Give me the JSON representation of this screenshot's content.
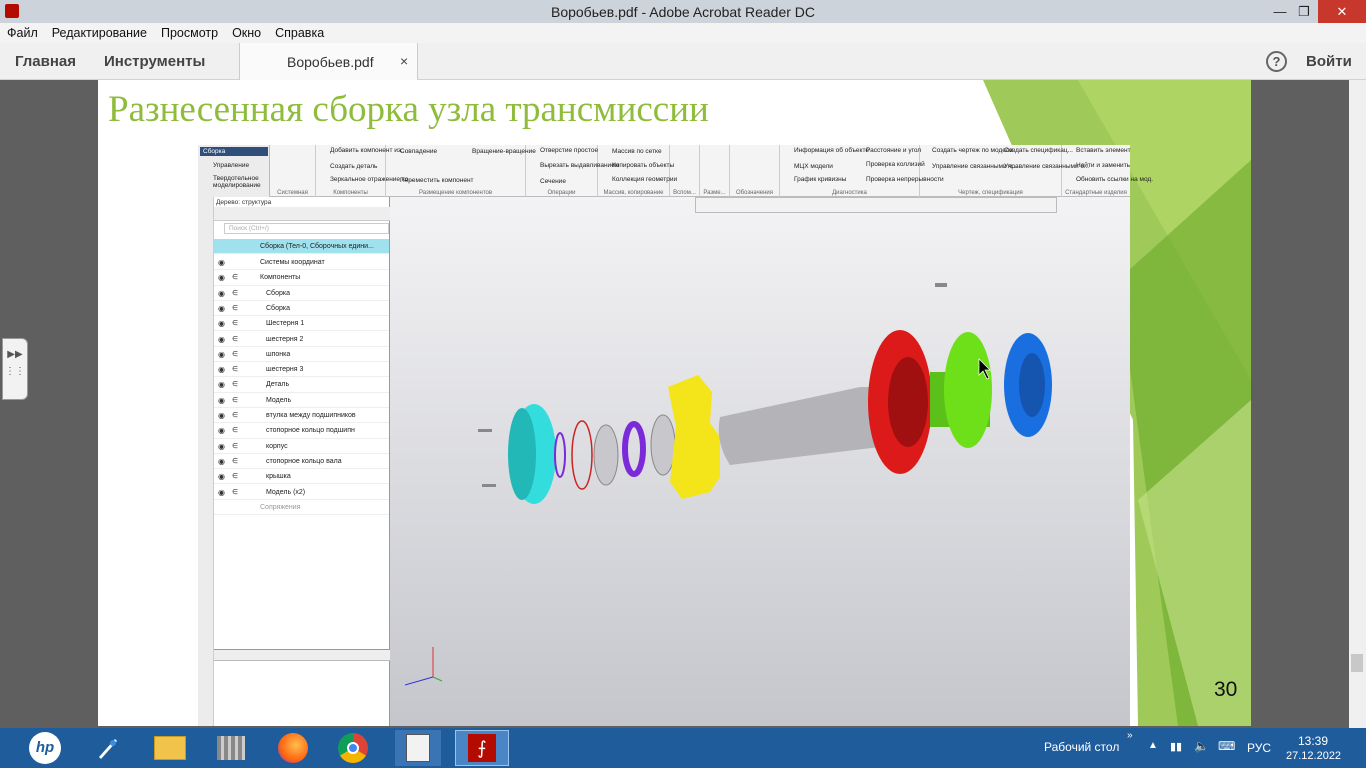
{
  "window": {
    "title": "Воробьев.pdf - Adobe Acrobat Reader DC",
    "minimize": "—",
    "restore": "❐",
    "close": "✕"
  },
  "menu": [
    "Файл",
    "Редактирование",
    "Просмотр",
    "Окно",
    "Справка"
  ],
  "tabs": {
    "home": "Главная",
    "tools": "Инструменты",
    "document": "Воробьев.pdf",
    "close_symbol": "×"
  },
  "header_right": {
    "help": "?",
    "login": "Войти"
  },
  "slide": {
    "title": "Разнесенная сборка узла трансмиссии",
    "page_number": "30"
  },
  "kompas": {
    "tree_tabs": [
      "Сборка",
      "Управление",
      "Твердотельное моделирование"
    ],
    "ribbon_groups": [
      {
        "label": "Системная",
        "items": []
      },
      {
        "label": "Компоненты",
        "items": [
          "Добавить компонент из...",
          "Создать деталь",
          "Зеркальное отражение ко..."
        ]
      },
      {
        "label": "Размещение компонентов",
        "items": [
          "Совпадение",
          "Вращение-вращение",
          "Переместить компонент"
        ]
      },
      {
        "label": "Операции",
        "items": [
          "Отверстие простое",
          "Вырезать выдавливанием",
          "Сечение"
        ]
      },
      {
        "label": "Массив, копирование",
        "items": [
          "Массив по сетке",
          "Копировать объекты",
          "Коллекция геометрии"
        ]
      },
      {
        "label": "Вспом...",
        "items": []
      },
      {
        "label": "Разме...",
        "items": []
      },
      {
        "label": "Обозначения",
        "items": []
      },
      {
        "label": "Диагностика",
        "items": [
          "Информация об объекте",
          "МЦХ модели",
          "График кривизны",
          "Расстояние и угол",
          "Проверка коллизий",
          "Проверка непрерывности"
        ]
      },
      {
        "label": "Чертеж, спецификация",
        "items": [
          "Создать чертеж по модели",
          "Управление связанными ч...",
          "Создать спецификац...",
          "Управление связанными с..."
        ]
      },
      {
        "label": "Стандартные изделия",
        "items": [
          "Вставить элемент",
          "Найти и заменить",
          "Обновить ссылки на мод."
        ]
      }
    ],
    "tree_header": "Дерево: структура",
    "search_placeholder": "Поиск (Ctrl+/)",
    "root_item": "Сборка (Тел-0, Сборочных едини...",
    "tree_items": [
      "Системы координат",
      "Компоненты",
      "Сборка",
      "Сборка",
      "Шестерня 1",
      "шестерня 2",
      "шпонка",
      "шестерня 3",
      "Деталь",
      "Модель",
      "втулка между подшипников",
      "стопорное кольцо подшипн",
      "корпус",
      "стопорное кольцо вала",
      "крышка",
      "Модель (x2)",
      "Сопряжения"
    ],
    "part_colors": {
      "flange": "#33dddd",
      "housing": "#f4e41a",
      "gear_red": "#dd1a1a",
      "gear_green": "#6ee01a",
      "gear_blue": "#1a6fe0",
      "ring": "#7a2ad8",
      "shaft": "#b4b4b8"
    }
  },
  "taskbar": {
    "desktop_label": "Рабочий стол",
    "language": "РУС",
    "time": "13:39",
    "date": "27.12.2022"
  },
  "colors": {
    "title_green": "#8fbc3c",
    "taskbar_blue": "#1f5c9c",
    "acrobat_red": "#b30b00"
  }
}
